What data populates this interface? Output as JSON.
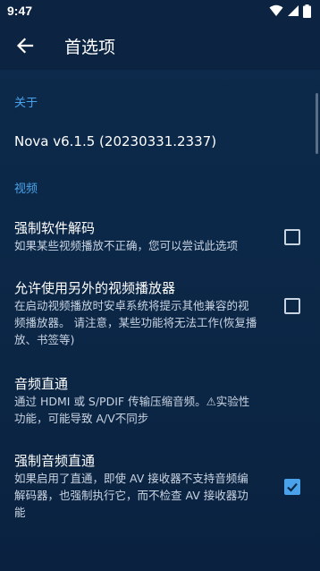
{
  "status_bar": {
    "time": "9:47",
    "icons": [
      "wifi-icon",
      "signal-icon",
      "battery-icon"
    ]
  },
  "app_bar": {
    "back_icon": "arrow-back-icon",
    "title": "首选项"
  },
  "sections": [
    {
      "header": "关于",
      "items": [
        {
          "title": "Nova v6.1.5 (20230331.2337)"
        }
      ]
    },
    {
      "header": "视频",
      "items": [
        {
          "title": "强制软件解码",
          "summary": "如果某些视频播放不正确，您可以尝试此选项",
          "checked": false
        },
        {
          "title": "允许使用另外的视频播放器",
          "summary": "在启动视频播放时安卓系统将提示其他兼容的视频播放器。 请注意，某些功能将无法工作(恢复播放、书签等)",
          "checked": false
        },
        {
          "title": "音频直通",
          "summary": "通过 HDMI 或 S/PDIF 传输压缩音频。⚠实验性功能，可能导致 A/V不同步"
        },
        {
          "title": "强制音频直通",
          "summary": "如果启用了直通，即使 AV 接收器不支持音频编解码器，也强制执行它，而不检查 AV 接收器功能",
          "checked": true
        }
      ]
    }
  ],
  "colors": {
    "accent": "#4aa3ea",
    "background": "#0c2848",
    "summary_text": "#c9d4e2"
  }
}
